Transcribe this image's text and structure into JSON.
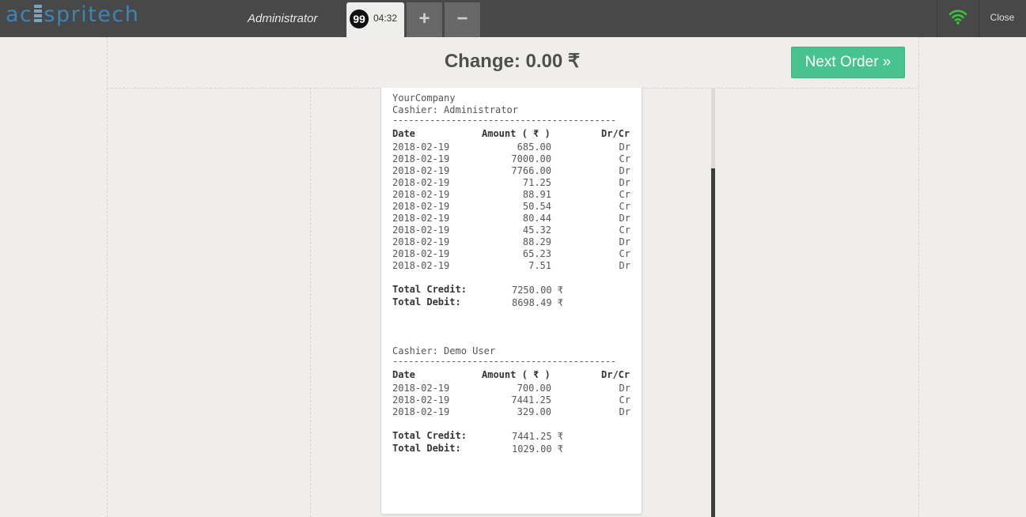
{
  "topbar": {
    "logo_left": "ac",
    "logo_right": "spritech",
    "user": "Administrator",
    "order_badge": "99",
    "order_time": "04:32",
    "add_label": "+",
    "remove_label": "−",
    "close_label": "Close"
  },
  "header": {
    "change_text": "Change: 0.00 ₹",
    "next_order_label": "Next Order »"
  },
  "receipt": {
    "company": "YourCompany",
    "divider": "------------------------------------------",
    "columns": {
      "date": "Date",
      "amount": "Amount ( ₹ )",
      "drcr": "Dr/Cr"
    },
    "sections": [
      {
        "cashier": "Cashier: Administrator",
        "rows": [
          {
            "date": "2018-02-19",
            "amount": "685.00",
            "type": "Dr"
          },
          {
            "date": "2018-02-19",
            "amount": "7000.00",
            "type": "Cr"
          },
          {
            "date": "2018-02-19",
            "amount": "7766.00",
            "type": "Dr"
          },
          {
            "date": "2018-02-19",
            "amount": "71.25",
            "type": "Dr"
          },
          {
            "date": "2018-02-19",
            "amount": "88.91",
            "type": "Cr"
          },
          {
            "date": "2018-02-19",
            "amount": "50.54",
            "type": "Cr"
          },
          {
            "date": "2018-02-19",
            "amount": "80.44",
            "type": "Dr"
          },
          {
            "date": "2018-02-19",
            "amount": "45.32",
            "type": "Cr"
          },
          {
            "date": "2018-02-19",
            "amount": "88.29",
            "type": "Dr"
          },
          {
            "date": "2018-02-19",
            "amount": "65.23",
            "type": "Cr"
          },
          {
            "date": "2018-02-19",
            "amount": "7.51",
            "type": "Dr"
          }
        ],
        "total_credit_label": "Total Credit:",
        "total_credit": "7250.00 ₹",
        "total_debit_label": "Total Debit:",
        "total_debit": "8698.49 ₹"
      },
      {
        "cashier": "Cashier: Demo User",
        "rows": [
          {
            "date": "2018-02-19",
            "amount": "700.00",
            "type": "Dr"
          },
          {
            "date": "2018-02-19",
            "amount": "7441.25",
            "type": "Cr"
          },
          {
            "date": "2018-02-19",
            "amount": "329.00",
            "type": "Dr"
          }
        ],
        "total_credit_label": "Total Credit:",
        "total_credit": "7441.25 ₹",
        "total_debit_label": "Total Debit:",
        "total_debit": "1029.00 ₹"
      }
    ]
  },
  "colors": {
    "topbar": "#484848",
    "accent_green": "#48c28e",
    "wifi": "#3cc13c",
    "logo_blue": "#3a86b6"
  }
}
